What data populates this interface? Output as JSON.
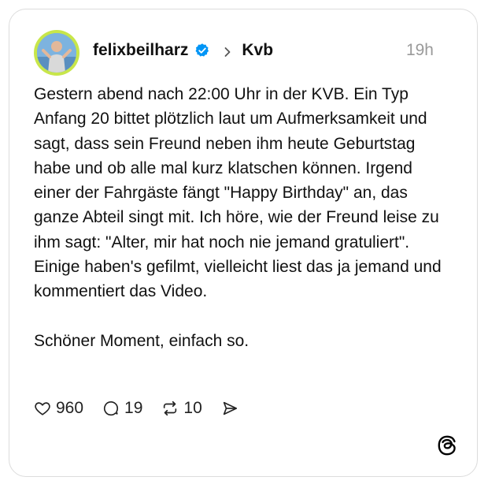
{
  "post": {
    "author": "felixbeilharz",
    "community": "Kvb",
    "time": "19h",
    "paragraphs": [
      "Gestern abend nach 22:00 Uhr in der KVB. Ein Typ Anfang 20 bittet plötzlich laut um Aufmerksamkeit und sagt, dass sein Freund neben ihm heute Geburtstag habe und ob alle mal kurz klatschen können. Irgend einer der Fahrgäste fängt \"Happy Birthday\" an, das ganze Abteil singt mit. Ich höre, wie der Freund leise zu ihm sagt: \"Alter, mir hat noch nie jemand gratuliert\". Einige haben's gefilmt, vielleicht liest das ja jemand und kommentiert das Video.",
      "Schöner Moment, einfach so."
    ],
    "likes": "960",
    "replies": "19",
    "reposts": "10"
  },
  "icons": {
    "verified": "verified-badge-icon",
    "chevron": "chevron-right-icon",
    "like": "heart-icon",
    "reply": "comment-icon",
    "repost": "repost-icon",
    "share": "send-icon",
    "brand": "threads-logo-icon"
  },
  "colors": {
    "verified": "#0095f6",
    "avatar_ring": "#c8e64a",
    "muted": "#9a9a9a"
  }
}
